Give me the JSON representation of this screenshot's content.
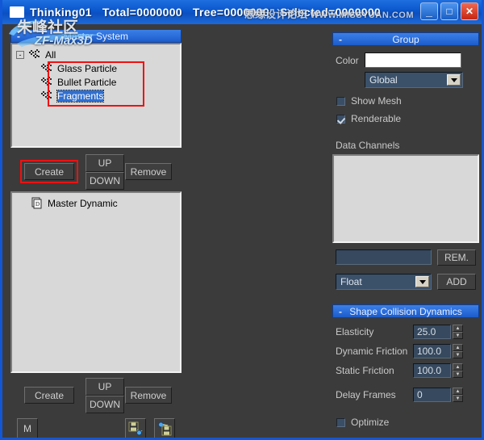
{
  "titlebar": {
    "app_icon": "window-icon",
    "title": "Thinking01",
    "stats": [
      "Total=0000000",
      "Tree=0000000",
      "Selected=0000000"
    ],
    "buttons": {
      "minimize": "_",
      "maximize": "□",
      "close": "✕"
    }
  },
  "watermarks": {
    "forum_cn": "思缘设计论坛",
    "url": "WWW.MISSYUAN.COM",
    "community_cn": "朱峰社区",
    "zf_brand": "ZF-Max3D"
  },
  "left_panel": {
    "master_system": {
      "header": "Master System",
      "collapse_glyph": "-",
      "tree": [
        {
          "label": "All",
          "depth": 0,
          "expander": "-",
          "icon": "particle-icon",
          "selected": false
        },
        {
          "label": "Glass Particle",
          "depth": 1,
          "expander": "",
          "icon": "particle-icon",
          "selected": false
        },
        {
          "label": "Bullet Particle",
          "depth": 1,
          "expander": "",
          "icon": "particle-icon",
          "selected": false
        },
        {
          "label": "Fragments",
          "depth": 1,
          "expander": "",
          "icon": "particle-icon",
          "selected": true
        }
      ],
      "buttons": {
        "create": "Create",
        "up": "UP",
        "down": "DOWN",
        "remove": "Remove"
      }
    },
    "dynamic_list": {
      "items": [
        {
          "label": "Master Dynamic",
          "icon": "document-stack-icon"
        }
      ],
      "buttons": {
        "create": "Create",
        "up": "UP",
        "down": "DOWN",
        "remove": "Remove"
      },
      "m_button": "M",
      "icon_buttons": [
        {
          "name": "save-to-file-icon"
        },
        {
          "name": "load-from-file-icon"
        }
      ]
    }
  },
  "right_panel": {
    "group": {
      "header": "Group",
      "collapse_glyph": "-",
      "color_label": "Color",
      "color_value": "#ffffff",
      "mode_select": "Global",
      "show_mesh": {
        "label": "Show Mesh",
        "checked": false
      },
      "renderable": {
        "label": "Renderable",
        "checked": true
      }
    },
    "data_channels": {
      "label": "Data Channels",
      "items": [],
      "name_field": "",
      "rem_button": "REM.",
      "type_select": "Float",
      "add_button": "ADD"
    },
    "shape_collision_dynamics": {
      "header": "Shape Collision Dynamics",
      "collapse_glyph": "-",
      "rows": [
        {
          "label": "Elasticity",
          "value": "25.0"
        },
        {
          "label": "Dynamic Friction",
          "value": "100.0"
        },
        {
          "label": "Static Friction",
          "value": "100.0"
        }
      ],
      "delay_frames": {
        "label": "Delay Frames",
        "value": "0"
      },
      "optimize": {
        "label": "Optimize",
        "checked": false
      }
    }
  },
  "colors": {
    "window_bg": "#3b3b3b",
    "accent_blue": "#1157d6",
    "header_blue": "#2a6bd8",
    "field_blue": "#36495e",
    "listbox_gray": "#d8d8d8",
    "highlight_red": "#ee1111"
  }
}
